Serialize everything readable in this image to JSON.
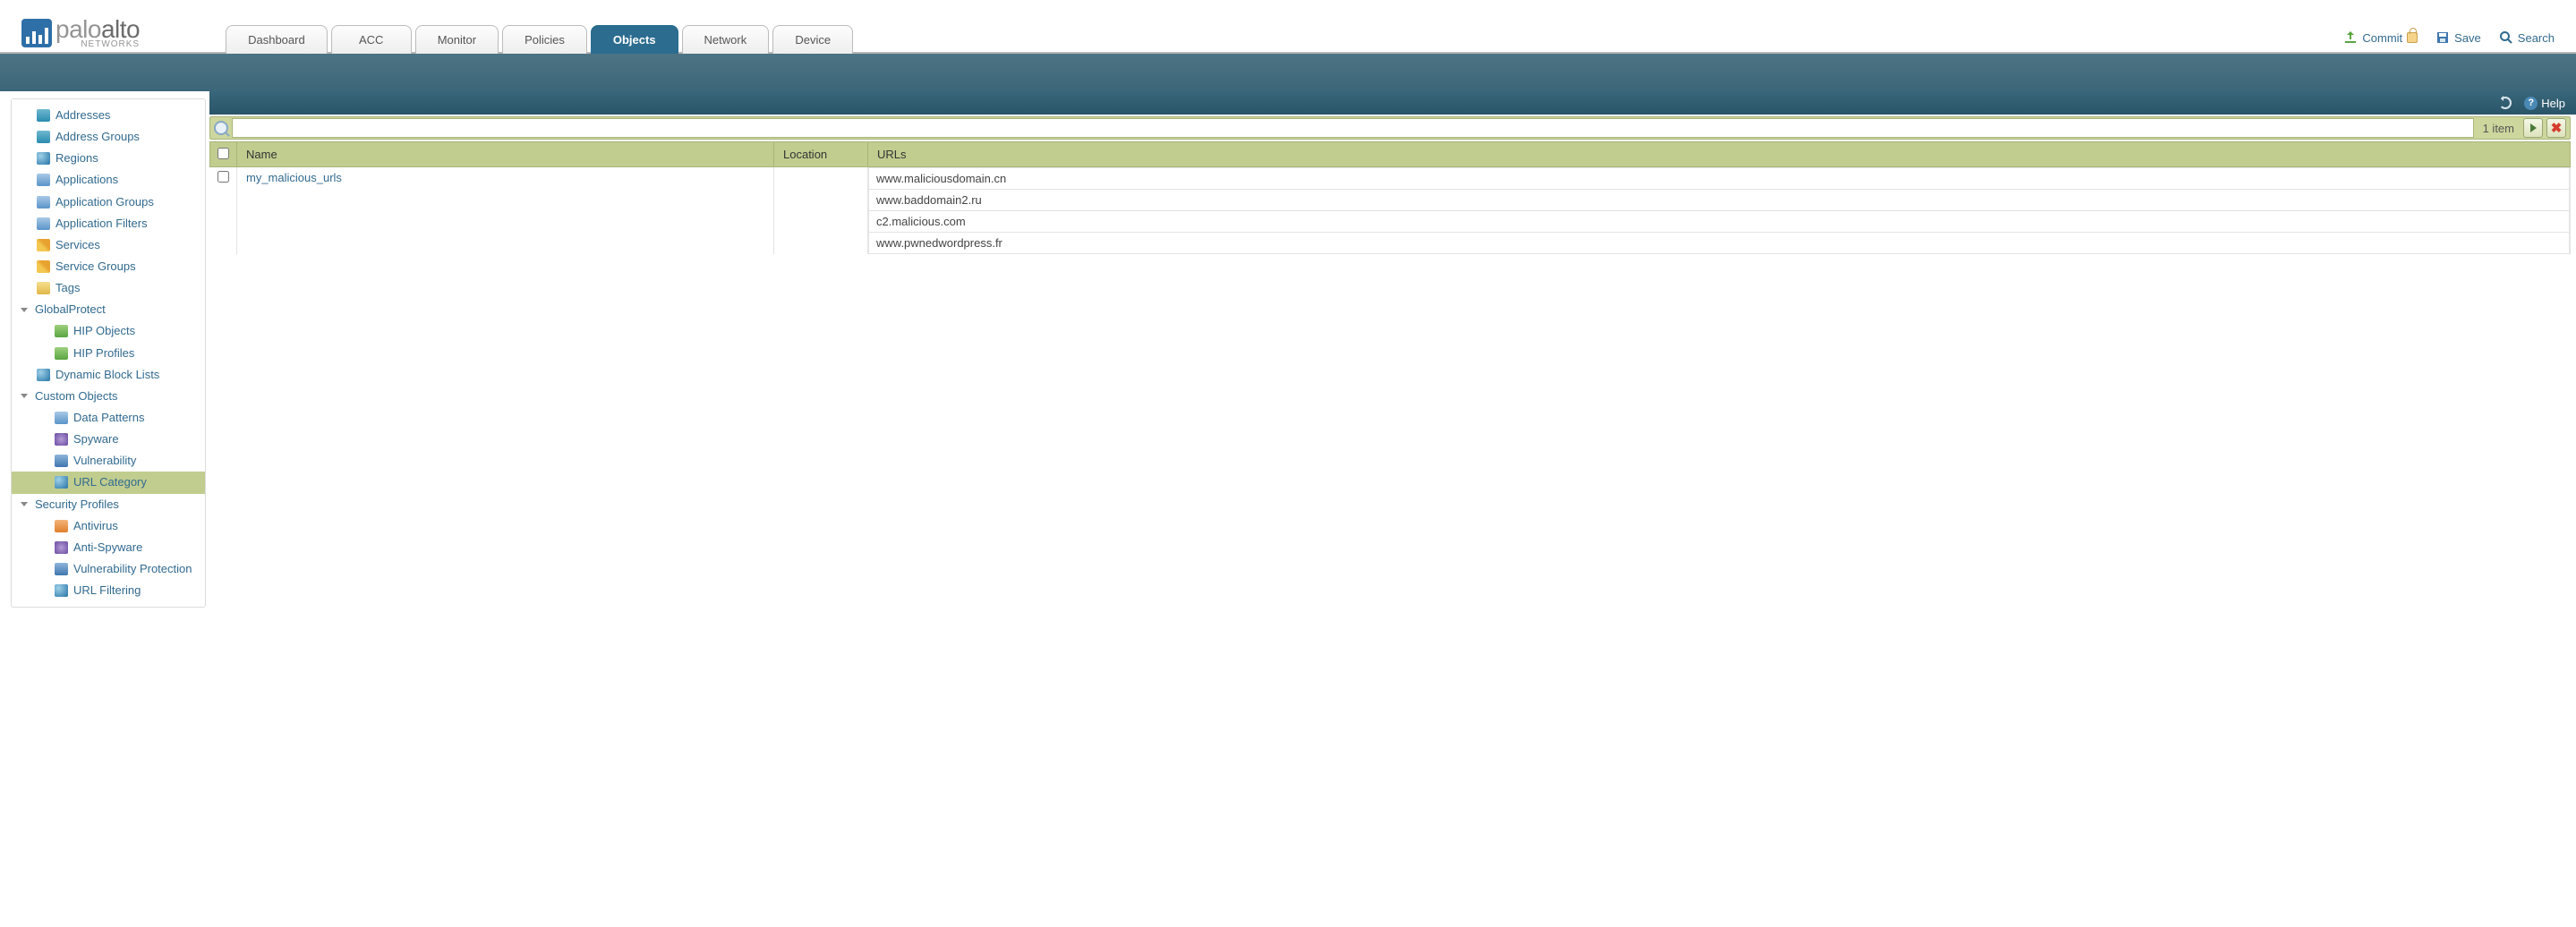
{
  "logo": {
    "line1a": "palo",
    "line1b": "alto",
    "line2": "NETWORKS"
  },
  "tabs": [
    "Dashboard",
    "ACC",
    "Monitor",
    "Policies",
    "Objects",
    "Network",
    "Device"
  ],
  "active_tab": "Objects",
  "header_actions": {
    "commit": "Commit",
    "save": "Save",
    "search": "Search"
  },
  "toolbar": {
    "help": "Help"
  },
  "sidebar": {
    "items": [
      {
        "label": "Addresses"
      },
      {
        "label": "Address Groups"
      },
      {
        "label": "Regions"
      },
      {
        "label": "Applications"
      },
      {
        "label": "Application Groups"
      },
      {
        "label": "Application Filters"
      },
      {
        "label": "Services"
      },
      {
        "label": "Service Groups"
      },
      {
        "label": "Tags"
      }
    ],
    "globalprotect": {
      "label": "GlobalProtect",
      "children": [
        "HIP Objects",
        "HIP Profiles"
      ]
    },
    "dynamic_block": "Dynamic Block Lists",
    "custom_objects": {
      "label": "Custom Objects",
      "children": [
        "Data Patterns",
        "Spyware",
        "Vulnerability",
        "URL Category"
      ]
    },
    "security_profiles": {
      "label": "Security Profiles",
      "children": [
        "Antivirus",
        "Anti-Spyware",
        "Vulnerability Protection",
        "URL Filtering"
      ]
    },
    "selected": "URL Category"
  },
  "search": {
    "placeholder": "",
    "count_text": "1 item"
  },
  "grid": {
    "columns": [
      "Name",
      "Location",
      "URLs"
    ],
    "rows": [
      {
        "name": "my_malicious_urls",
        "location": "",
        "urls": [
          "www.maliciousdomain.cn",
          "www.baddomain2.ru",
          "c2.malicious.com",
          "www.pwnedwordpress.fr"
        ]
      }
    ]
  }
}
